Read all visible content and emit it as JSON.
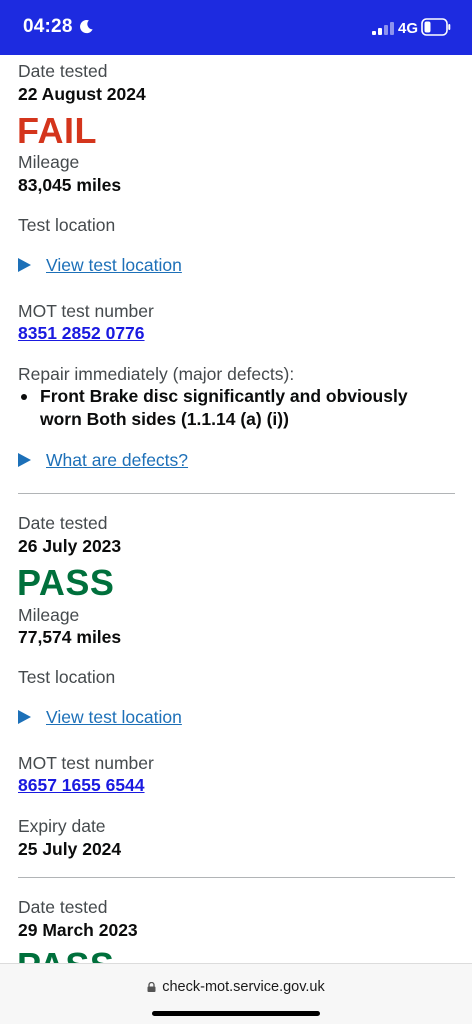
{
  "status_bar": {
    "time": "04:28",
    "network": "4G",
    "icons": [
      "moon-icon",
      "signal-icon",
      "battery-icon"
    ]
  },
  "labels": {
    "date_tested": "Date tested",
    "mileage": "Mileage",
    "test_location": "Test location",
    "view_test_location": "View test location",
    "mot_test_number": "MOT test number",
    "expiry_date": "Expiry date",
    "repair_immediately": "Repair immediately (major defects):",
    "what_are_defects": "What are defects?"
  },
  "tests": [
    {
      "date": "22 August 2024",
      "result": "FAIL",
      "mileage": "83,045 miles",
      "mot_number": "8351 2852 0776",
      "defects": [
        "Front Brake disc significantly and obviously worn Both sides (1.1.14 (a) (i))"
      ]
    },
    {
      "date": "26 July 2023",
      "result": "PASS",
      "mileage": "77,574 miles",
      "mot_number": "8657 1655 6544",
      "expiry": "25 July 2024"
    },
    {
      "date": "29 March 2023",
      "result": "PASS"
    }
  ],
  "browser": {
    "url": "check-mot.service.gov.uk"
  },
  "colors": {
    "status_bar": "#1d2be0",
    "fail": "#d4351c",
    "pass": "#00703c",
    "link": "#1d70b8"
  }
}
